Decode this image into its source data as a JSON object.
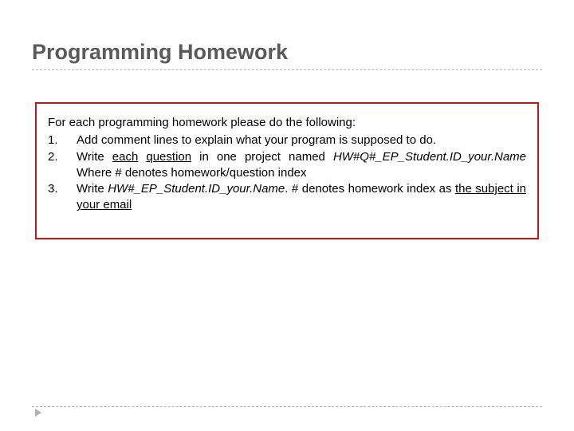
{
  "title": "Programming Homework",
  "intro": "For each programming homework please do the following:",
  "items": {
    "i1": "Add comment lines to explain what your program is supposed to do.",
    "i2": {
      "p1": "Write ",
      "u1": "each",
      "p2": " ",
      "u2": "question",
      "p3": " in one project named ",
      "it1": "HW#Q#_EP_Student.ID_your.Name",
      "p4": " Where # denotes homework/question index"
    },
    "i3": {
      "p1": "Write ",
      "it1": "HW#_EP_Student.ID_your.Name",
      "p2": ". # denotes homework index as ",
      "u1": "the subject in your email"
    }
  }
}
